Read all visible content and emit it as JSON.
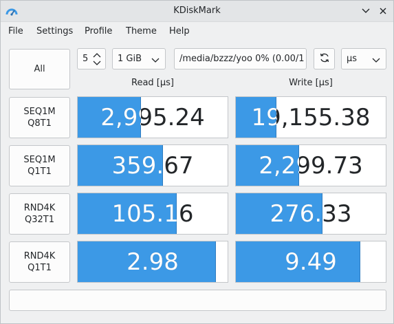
{
  "window": {
    "title": "KDiskMark"
  },
  "menu": [
    "File",
    "Settings",
    "Profile",
    "Theme",
    "Help"
  ],
  "toolbar": {
    "all_label": "All",
    "runs_value": "5",
    "size_value": "1 GiB",
    "path_value": "/media/bzzz/yoo 0% (0.00/1",
    "unit_value": "μs"
  },
  "columns": {
    "read": "Read [μs]",
    "write": "Write [μs]"
  },
  "tests": [
    {
      "line1": "SEQ1M",
      "line2": "Q8T1",
      "read": "2,995.24",
      "read_fill": 0.42,
      "write": "19,155.38",
      "write_fill": 0.27
    },
    {
      "line1": "SEQ1M",
      "line2": "Q1T1",
      "read": "359.67",
      "read_fill": 0.57,
      "write": "2,299.73",
      "write_fill": 0.42
    },
    {
      "line1": "RND4K",
      "line2": "Q32T1",
      "read": "105.16",
      "read_fill": 0.66,
      "write": "276.33",
      "write_fill": 0.58
    },
    {
      "line1": "RND4K",
      "line2": "Q1T1",
      "read": "2.98",
      "read_fill": 0.92,
      "write": "9.49",
      "write_fill": 0.83
    }
  ],
  "status": ""
}
